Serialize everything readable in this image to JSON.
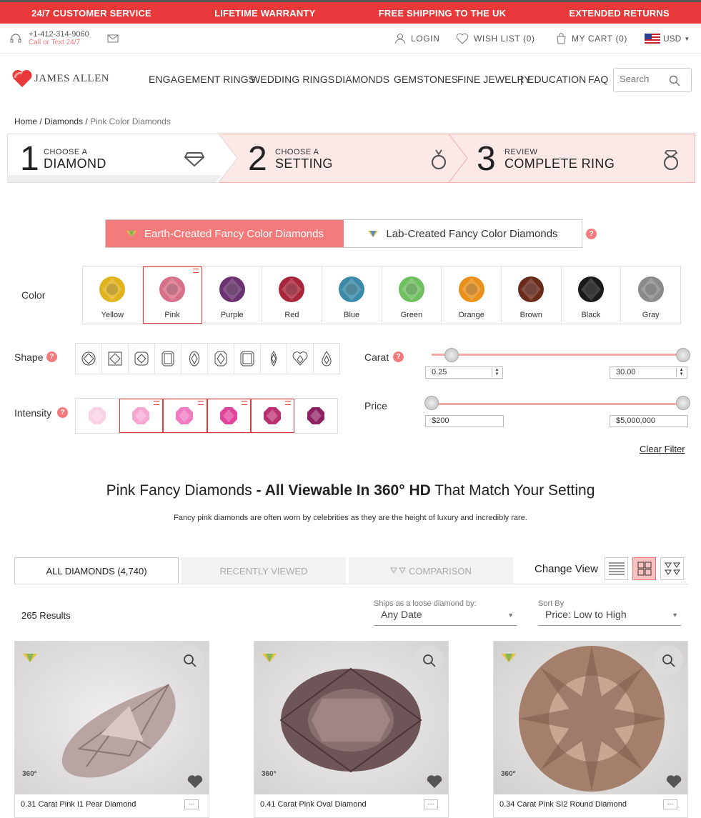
{
  "topbar": [
    "24/7 CUSTOMER SERVICE",
    "LIFETIME WARRANTY",
    "FREE SHIPPING TO THE UK",
    "EXTENDED RETURNS"
  ],
  "util": {
    "phone": "+1-412-314-9060",
    "phone_sub": "Call or Text 24/7",
    "login": "LOGIN",
    "wishlist": "WISH LIST (0)",
    "cart": "MY CART (0)",
    "currency": "USD"
  },
  "brand": {
    "logo": "JAMES ALLEN",
    "color": "#e8393a"
  },
  "nav": [
    "ENGAGEMENT RINGS",
    "WEDDING RINGS",
    "DIAMONDS",
    "GEMSTONES",
    "FINE JEWELRY",
    "|",
    "EDUCATION",
    "FAQ"
  ],
  "search": {
    "placeholder": "Search"
  },
  "breadcrumb": {
    "home": "Home",
    "sep": " / ",
    "diamonds": "Diamonds",
    "current": "Pink Color Diamonds"
  },
  "steps": [
    {
      "num": "1",
      "small": "CHOOSE A",
      "large": "DIAMOND"
    },
    {
      "num": "2",
      "small": "CHOOSE A",
      "large": "SETTING"
    },
    {
      "num": "3",
      "small": "REVIEW",
      "large": "COMPLETE RING"
    }
  ],
  "toggle": {
    "earth": "Earth-Created Fancy Color Diamonds",
    "lab": "Lab-Created Fancy Color Diamonds"
  },
  "filters": {
    "color": "Color",
    "shape": "Shape",
    "intensity": "Intensity",
    "carat": "Carat",
    "price": "Price",
    "clear": "Clear Filter"
  },
  "colors": [
    {
      "name": "Yellow",
      "hex": "#e0b21c"
    },
    {
      "name": "Pink",
      "hex": "#d9708a"
    },
    {
      "name": "Purple",
      "hex": "#6a3270"
    },
    {
      "name": "Red",
      "hex": "#a8263a"
    },
    {
      "name": "Blue",
      "hex": "#3a8aa8"
    },
    {
      "name": "Green",
      "hex": "#6fbf60"
    },
    {
      "name": "Orange",
      "hex": "#e8901a"
    },
    {
      "name": "Brown",
      "hex": "#6a2a1a"
    },
    {
      "name": "Black",
      "hex": "#1a1a1a"
    },
    {
      "name": "Gray",
      "hex": "#8a8a8a"
    }
  ],
  "selected_color": "Pink",
  "intensity_colors": [
    "#f9d3e3",
    "#f6a8d2",
    "#ef7ac0",
    "#e0429c",
    "#bb2f6f",
    "#8d2160"
  ],
  "carat": {
    "min": "0.25",
    "max": "30.00"
  },
  "price": {
    "min": "$200",
    "max": "$5,000,000"
  },
  "headline": {
    "a": "Pink Fancy Diamonds ",
    "b": "- All Viewable In 360° HD",
    "c": " That Match Your Setting"
  },
  "subtitle": "Fancy pink diamonds are often worn by celebrities as they are the height of luxury and incredibly rare.",
  "tabs": {
    "all": "ALL DIAMONDS (4,740)",
    "recent": "RECENTLY VIEWED",
    "compare": "COMPARISON"
  },
  "view": {
    "label": "Change View"
  },
  "results": "265 Results",
  "ships": {
    "label": "Ships as a loose diamond by:",
    "value": "Any Date"
  },
  "sort": {
    "label": "Sort By",
    "value": "Price: Low to High"
  },
  "cards": [
    {
      "caption": "0.31 Carat Pink I1 Pear Diamond",
      "badge": "360°"
    },
    {
      "caption": "0.41 Carat Pink Oval Diamond",
      "badge": "360°"
    },
    {
      "caption": "0.34 Carat Pink SI2 Round Diamond",
      "badge": "360°"
    }
  ],
  "more": "···"
}
